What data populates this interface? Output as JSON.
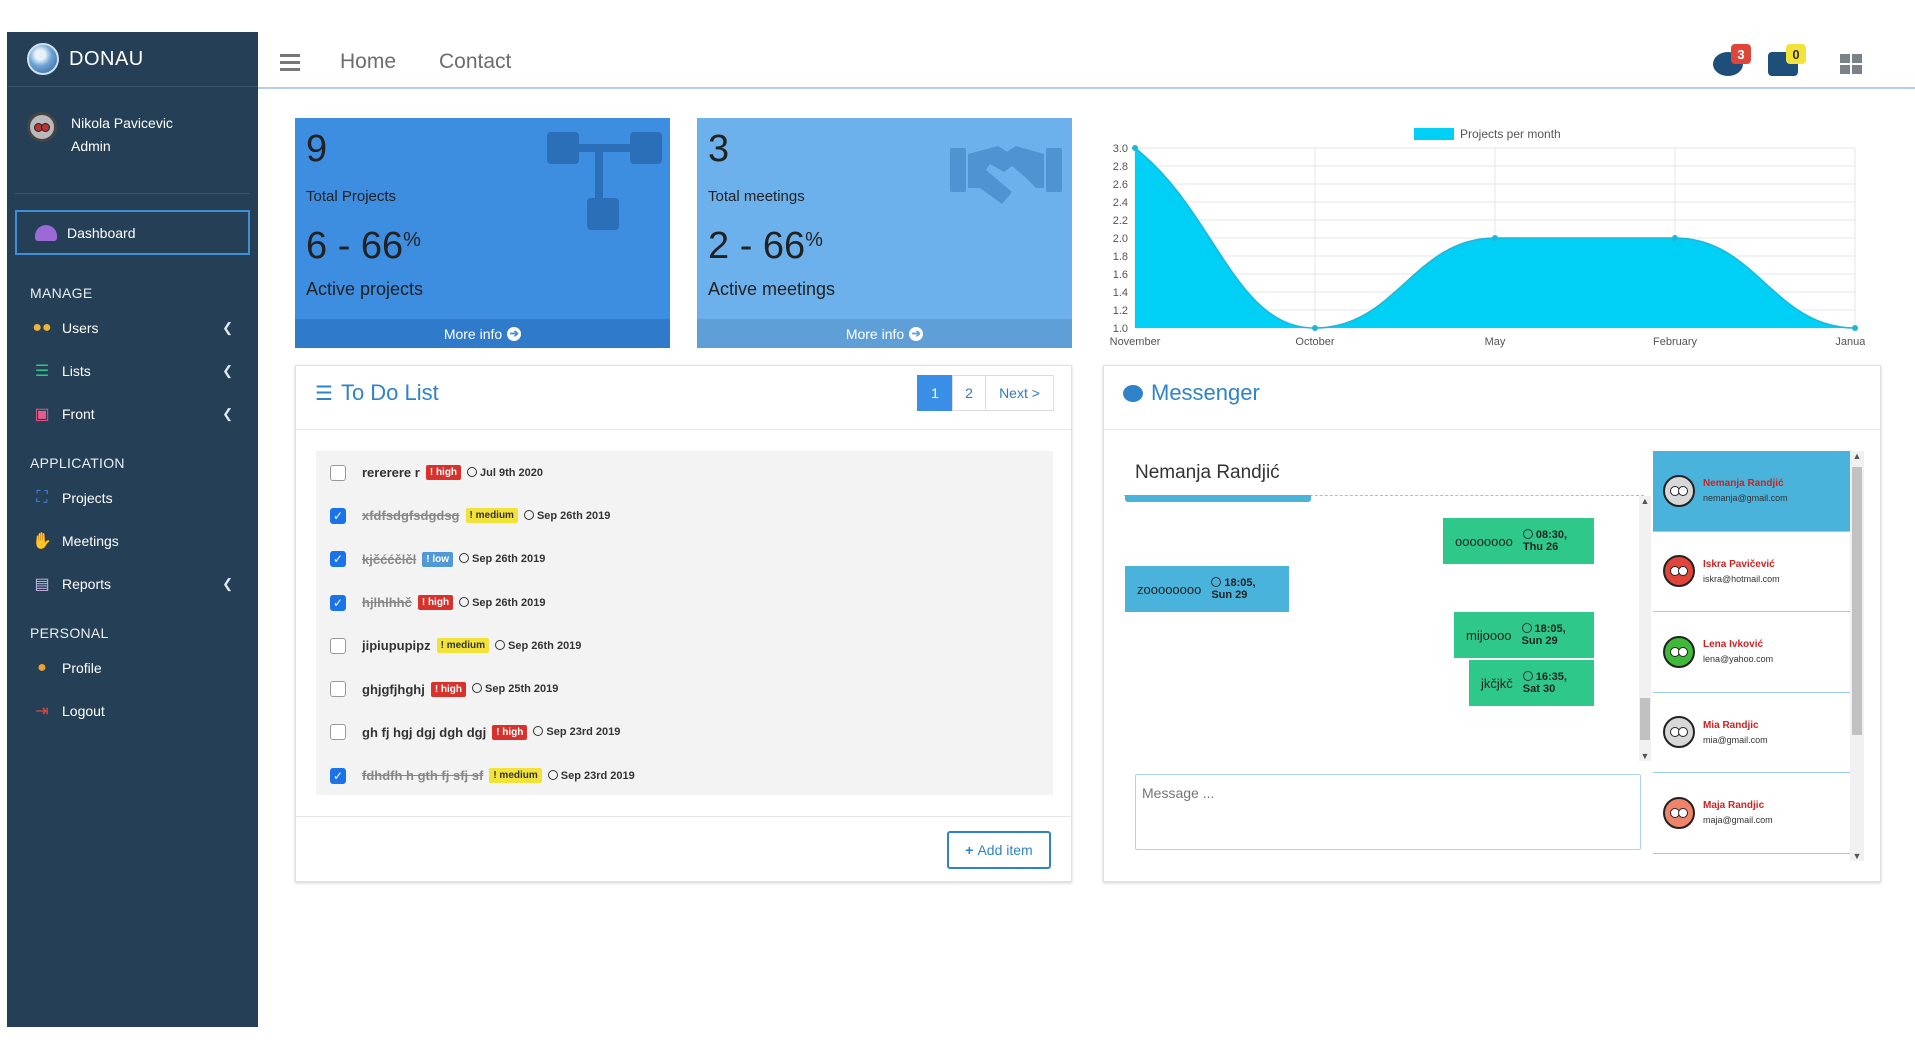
{
  "sidebar": {
    "brand": "DONAU",
    "user": {
      "name": "Nikola Pavicevic",
      "role": "Admin"
    },
    "dashboard": "Dashboard",
    "sections": {
      "manage": "MANAGE",
      "application": "APPLICATION",
      "personal": "PERSONAL"
    },
    "items": {
      "users": "Users",
      "lists": "Lists",
      "front": "Front",
      "projects": "Projects",
      "meetings": "Meetings",
      "reports": "Reports",
      "profile": "Profile",
      "logout": "Logout"
    }
  },
  "topbar": {
    "home": "Home",
    "contact": "Contact",
    "messages_count": "3",
    "notifications_count": "0"
  },
  "stats": {
    "projects": {
      "count": "9",
      "label": "Total Projects",
      "active": "6 - 66",
      "percent": "%",
      "active_label": "Active projects",
      "more": "More info"
    },
    "meetings": {
      "count": "3",
      "label": "Total meetings",
      "active": "2 - 66",
      "percent": "%",
      "active_label": "Active meetings",
      "more": "More info"
    }
  },
  "chart_data": {
    "type": "area",
    "legend": "Projects per month",
    "x": [
      "November",
      "October",
      "May",
      "February",
      "January"
    ],
    "values": [
      3.0,
      1.0,
      2.0,
      2.0,
      1.0
    ],
    "ylim": [
      1.0,
      3.0
    ],
    "yticks": [
      "3.0",
      "2.8",
      "2.6",
      "2.4",
      "2.2",
      "2.0",
      "1.8",
      "1.6",
      "1.4",
      "1.2",
      "1.0"
    ],
    "color": "#00d0f5",
    "grid": true,
    "legend_position": "top"
  },
  "todo": {
    "title": "To Do List",
    "pager": {
      "page1": "1",
      "page2": "2",
      "next": "Next >"
    },
    "items": [
      {
        "text": "rererere r",
        "priority": "high",
        "date": "Jul 9th 2020",
        "done": false
      },
      {
        "text": "xfdfsdgfsdgdsg",
        "priority": "medium",
        "date": "Sep 26th 2019",
        "done": true
      },
      {
        "text": "kjčććčlčl",
        "priority": "low",
        "date": "Sep 26th 2019",
        "done": true
      },
      {
        "text": "hjlhlhhč",
        "priority": "high",
        "date": "Sep 26th 2019",
        "done": true
      },
      {
        "text": "jipiupupipz",
        "priority": "medium",
        "date": "Sep 26th 2019",
        "done": false
      },
      {
        "text": "ghjgfjhghj",
        "priority": "high",
        "date": "Sep 25th 2019",
        "done": false
      },
      {
        "text": "gh fj hgj dgj dgh dgj",
        "priority": "high",
        "date": "Sep 23rd 2019",
        "done": false
      },
      {
        "text": "fdhdfh h gth fj sfj sf",
        "priority": "medium",
        "date": "Sep 23rd 2019",
        "done": true
      }
    ],
    "add_label": "Add item"
  },
  "messenger": {
    "title": "Messenger",
    "chat_with": "Nemanja Randjić",
    "messages": [
      {
        "text": "oooooooo",
        "time": "08:30, Thu 26",
        "mine": true
      },
      {
        "text": "zoooooooo",
        "time": "18:05, Sun 29",
        "mine": false
      },
      {
        "text": "mijoooo",
        "time": "18:05, Sun 29",
        "mine": true
      },
      {
        "text": "jkčjkč",
        "time": "16:35, Sat 30",
        "mine": true
      }
    ],
    "placeholder": "Message ...",
    "contacts": [
      {
        "name": "Nemanja Randjić",
        "email": "nemanja@gmail.com",
        "color": "#d8d8d8"
      },
      {
        "name": "Iskra Pavičević",
        "email": "iskra@hotmail.com",
        "color": "#e0453a"
      },
      {
        "name": "Lena Ivković",
        "email": "lena@yahoo.com",
        "color": "#3fb93a"
      },
      {
        "name": "Mia Randjic",
        "email": "mia@gmail.com",
        "color": "#d8d8d8"
      },
      {
        "name": "Maja Randjic",
        "email": "maja@gmail.com",
        "color": "#f0846a"
      }
    ]
  }
}
